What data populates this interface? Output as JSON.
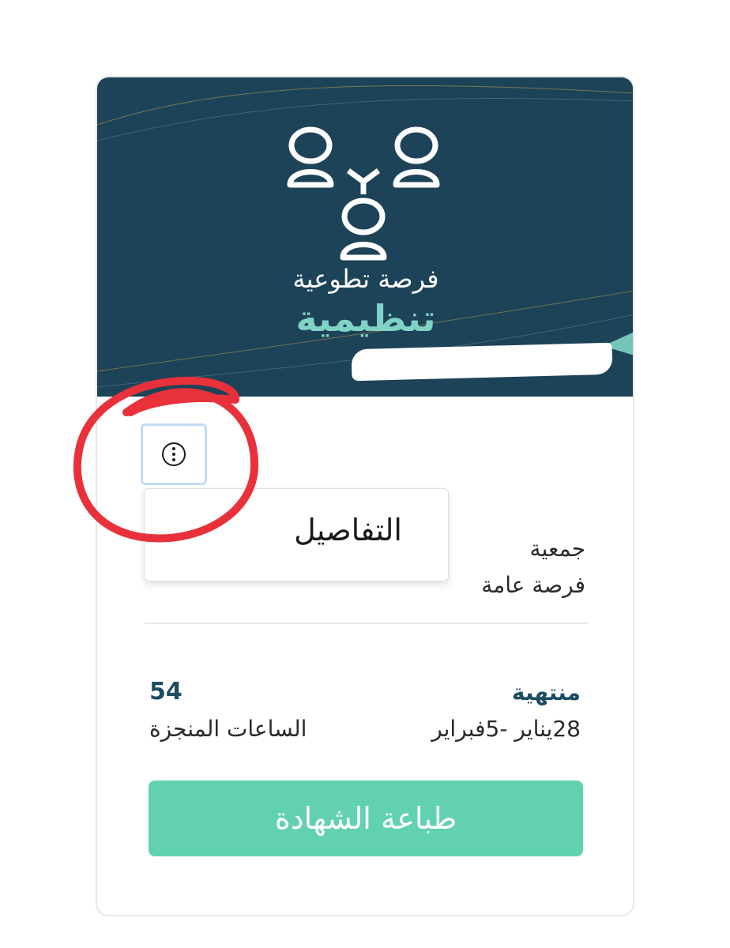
{
  "banner": {
    "line1": "فرصة تطوعية",
    "line2": "تنظيمية",
    "icon": "people-network-icon"
  },
  "card": {
    "menu_icon": "kebab-vertical-icon",
    "dropdown": {
      "details_label": "التفاصيل"
    },
    "org_name": "جمعية",
    "opportunity_type": "فرصة عامة",
    "status": "منتهية",
    "date_range": "28يناير -5فبراير",
    "hours_value": "54",
    "hours_label": "الساعات المنجزة",
    "print_button": "طباعة الشهادة"
  },
  "colors": {
    "banner_bg": "#1d4358",
    "accent_teal": "#7fd3c4",
    "button_green": "#62d1b0",
    "status_text": "#1e4d62",
    "annotation_red": "#e8313a"
  }
}
